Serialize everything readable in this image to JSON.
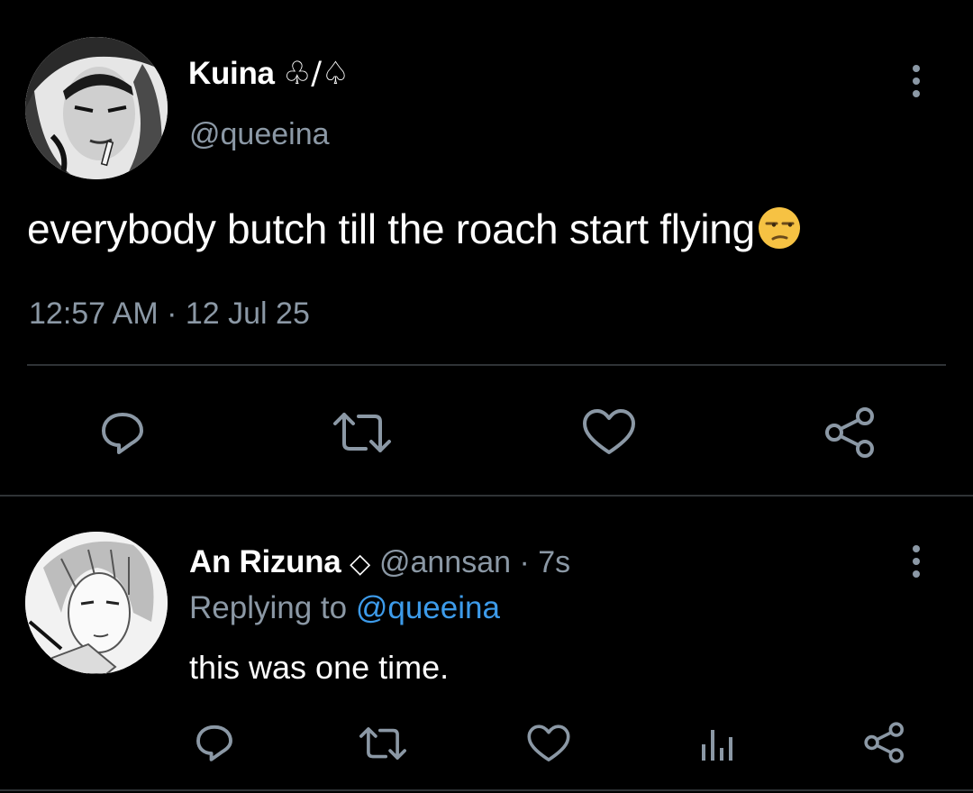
{
  "tweet": {
    "display_name": "Kuina",
    "name_symbols": "♧/♤",
    "handle": "@queeina",
    "text": "everybody butch till the roach start flying",
    "emoji": "😒",
    "timestamp": "12:57 AM · 12 Jul 25",
    "actions": [
      "reply-icon",
      "retweet-icon",
      "like-icon",
      "share-icon"
    ]
  },
  "reply": {
    "display_name": "An Rizuna",
    "name_symbol": "◇",
    "handle_time": "@annsan · 7s",
    "replying_prefix": "Replying to",
    "replying_handle": "@queeina",
    "text": "this was one time.",
    "actions": [
      "reply-icon",
      "retweet-icon",
      "like-icon",
      "analytics-icon",
      "share-icon"
    ]
  },
  "colors": {
    "background": "#000000",
    "text": "#ffffff",
    "muted": "#8b98a5",
    "link": "#3d9bea",
    "divider": "#2f3336"
  }
}
